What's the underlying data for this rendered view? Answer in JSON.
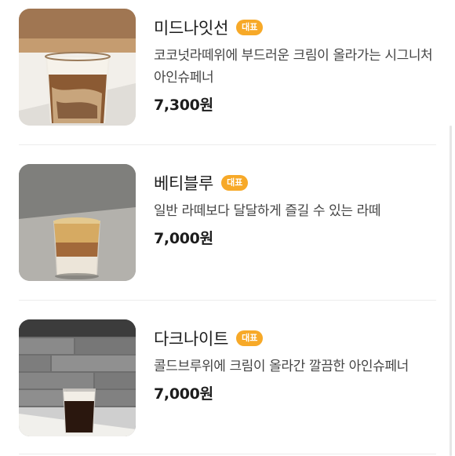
{
  "menu": {
    "items": [
      {
        "name": "미드나잇선",
        "badge": "대표",
        "description": "코코넛라떼위에 부드러운 크림이 올라가는 시그니처 아인슈페너",
        "price": "7,300원",
        "image": "iced-latte-glass-photo"
      },
      {
        "name": "베티블루",
        "badge": "대표",
        "description": "일반 라떼보다 달달하게 즐길 수 있는 라떼",
        "price": "7,000원",
        "image": "cream-latte-glass-photo"
      },
      {
        "name": "다크나이트",
        "badge": "대표",
        "description": "콜드브루위에 크림이 올라간 깔끔한 아인슈페너",
        "price": "7,000원",
        "image": "cold-brew-cream-glass-photo"
      }
    ]
  },
  "colors": {
    "badge": "#f7a928",
    "divider": "#ececec"
  }
}
